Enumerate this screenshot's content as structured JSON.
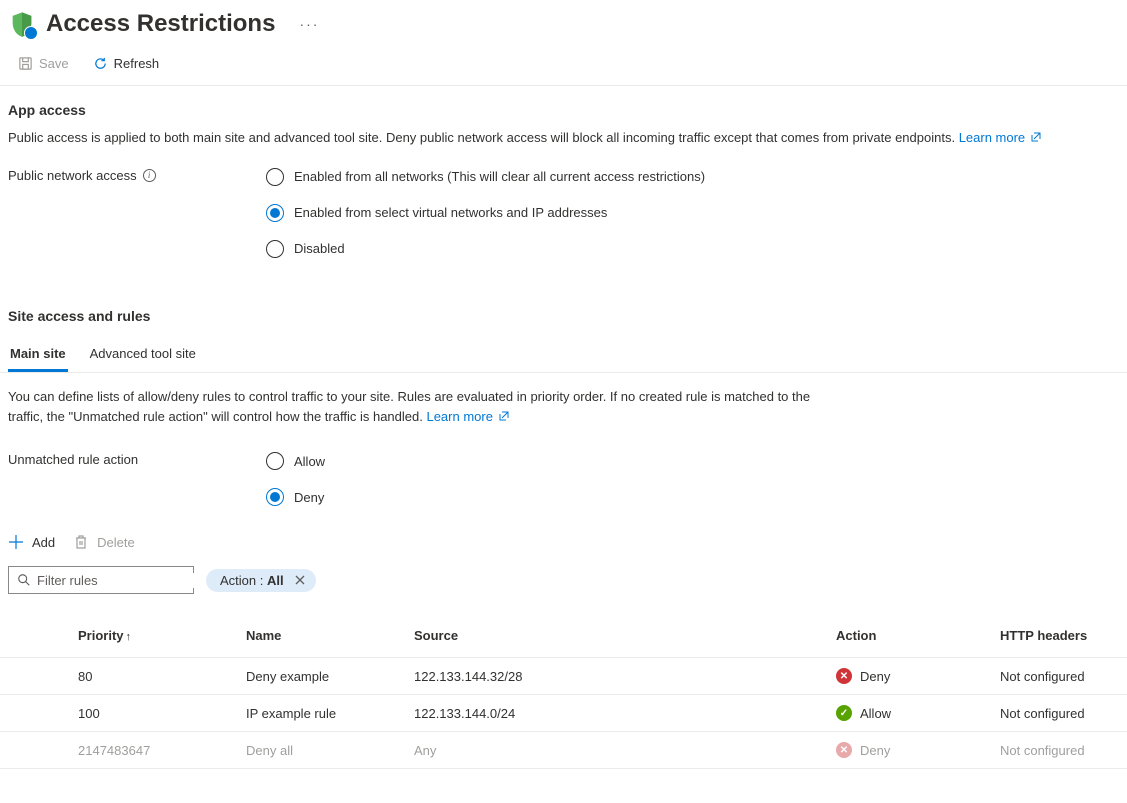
{
  "header": {
    "title": "Access Restrictions",
    "more": "···"
  },
  "toolbar": {
    "save": "Save",
    "refresh": "Refresh"
  },
  "appAccess": {
    "title": "App access",
    "desc": "Public access is applied to both main site and advanced tool site. Deny public network access will block all incoming traffic except that comes from private endpoints. ",
    "learnMore": "Learn more",
    "publicNetworkAccess": "Public network access",
    "options": {
      "enabledAll": "Enabled from all networks (This will clear all current access restrictions)",
      "enabledSelect": "Enabled from select virtual networks and IP addresses",
      "disabled": "Disabled"
    }
  },
  "siteAccess": {
    "title": "Site access and rules",
    "tabs": {
      "main": "Main site",
      "advanced": "Advanced tool site"
    },
    "desc": "You can define lists of allow/deny rules to control traffic to your site. Rules are evaluated in priority order. If no created rule is matched to the traffic, the \"Unmatched rule action\" will control how the traffic is handled. ",
    "learnMore": "Learn more",
    "unmatchedLabel": "Unmatched rule action",
    "unmatched": {
      "allow": "Allow",
      "deny": "Deny"
    }
  },
  "ruleToolbar": {
    "add": "Add",
    "delete": "Delete"
  },
  "filter": {
    "placeholder": "Filter rules",
    "pillLabel": "Action : ",
    "pillValue": "All"
  },
  "table": {
    "headers": {
      "priority": "Priority",
      "name": "Name",
      "source": "Source",
      "action": "Action",
      "http": "HTTP headers"
    },
    "rows": [
      {
        "priority": "80",
        "name": "Deny example",
        "source": "122.133.144.32/28",
        "action": "Deny",
        "actionType": "deny",
        "http": "Not configured",
        "muted": false
      },
      {
        "priority": "100",
        "name": "IP example rule",
        "source": "122.133.144.0/24",
        "action": "Allow",
        "actionType": "allow",
        "http": "Not configured",
        "muted": false
      },
      {
        "priority": "2147483647",
        "name": "Deny all",
        "source": "Any",
        "action": "Deny",
        "actionType": "deny-muted",
        "http": "Not configured",
        "muted": true
      }
    ]
  }
}
